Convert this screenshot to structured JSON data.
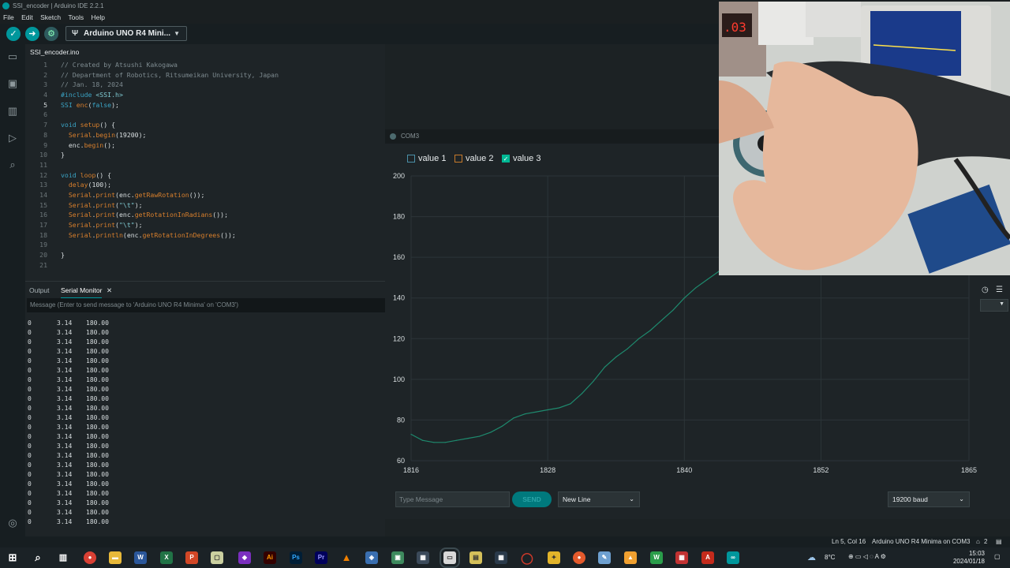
{
  "window": {
    "title": "SSI_encoder | Arduino IDE 2.2.1"
  },
  "menu": [
    "File",
    "Edit",
    "Sketch",
    "Tools",
    "Help"
  ],
  "toolbar": {
    "board": "Arduino UNO R4 Mini..."
  },
  "editor": {
    "file_tab": "SSI_encoder.ino",
    "current_line": 5,
    "lines": [
      "// Created by Atsushi Kakogawa",
      "// Department of Robotics, Ritsumeikan University, Japan",
      "// Jan. 18, 2024",
      "#include <SSI.h>",
      "SSI enc(false);",
      "",
      "void setup() {",
      "  Serial.begin(19200);",
      "  enc.begin();",
      "}",
      "",
      "void loop() {",
      "  delay(100);",
      "  Serial.print(enc.getRawRotation());",
      "  Serial.print(\"\\t\");",
      "  Serial.print(enc.getRotationInRadians());",
      "  Serial.print(\"\\t\");",
      "  Serial.println(enc.getRotationInDegrees());",
      "",
      "}",
      ""
    ]
  },
  "bottom_panel": {
    "tabs": [
      "Output",
      "Serial Monitor"
    ],
    "message_placeholder": "Message (Enter to send message to 'Arduino UNO R4 Minima' on 'COM3')",
    "serial_rows": [
      [
        "0",
        "3.14",
        "180.00"
      ],
      [
        "0",
        "3.14",
        "180.00"
      ],
      [
        "0",
        "3.14",
        "180.00"
      ],
      [
        "0",
        "3.14",
        "180.00"
      ],
      [
        "0",
        "3.14",
        "180.00"
      ],
      [
        "0",
        "3.14",
        "180.00"
      ],
      [
        "0",
        "3.14",
        "180.00"
      ],
      [
        "0",
        "3.14",
        "180.00"
      ],
      [
        "0",
        "3.14",
        "180.00"
      ],
      [
        "0",
        "3.14",
        "180.00"
      ],
      [
        "0",
        "3.14",
        "180.00"
      ],
      [
        "0",
        "3.14",
        "180.00"
      ],
      [
        "0",
        "3.14",
        "180.00"
      ],
      [
        "0",
        "3.14",
        "180.00"
      ],
      [
        "0",
        "3.14",
        "180.00"
      ],
      [
        "0",
        "3.14",
        "180.00"
      ],
      [
        "0",
        "3.14",
        "180.00"
      ],
      [
        "0",
        "3.14",
        "180.00"
      ],
      [
        "0",
        "3.14",
        "180.00"
      ],
      [
        "0",
        "3.14",
        "180.00"
      ],
      [
        "0",
        "3.14",
        "180.00"
      ],
      [
        "0",
        "3.14",
        "180.00"
      ]
    ]
  },
  "plotter": {
    "title": "COM3",
    "legend": [
      {
        "label": "value 1",
        "checked": false,
        "color": "#4a90a8"
      },
      {
        "label": "value 2",
        "checked": false,
        "color": "#c67a2b"
      },
      {
        "label": "value 3",
        "checked": true,
        "color": "#00b894"
      }
    ],
    "type_placeholder": "Type Message",
    "send_label": "SEND",
    "line_ending": "New Line",
    "baud": "19200 baud"
  },
  "chart_data": {
    "type": "line",
    "ylim": [
      60,
      200
    ],
    "yticks": [
      60,
      80,
      100,
      120,
      140,
      160,
      180,
      200
    ],
    "xlim": [
      1816,
      1865
    ],
    "xticks": [
      1816,
      1828,
      1840,
      1852,
      1865
    ],
    "series": [
      {
        "name": "value 3",
        "color": "#1e8a6e",
        "x": [
          1816,
          1817,
          1818,
          1819,
          1820,
          1821,
          1822,
          1823,
          1824,
          1825,
          1826,
          1827,
          1828,
          1829,
          1830,
          1831,
          1832,
          1833,
          1834,
          1835,
          1836,
          1837,
          1838,
          1839,
          1840,
          1841,
          1842,
          1843,
          1844,
          1845
        ],
        "y": [
          73,
          70,
          69,
          69,
          70,
          71,
          72,
          74,
          77,
          81,
          83,
          84,
          85,
          86,
          88,
          93,
          99,
          106,
          111,
          115,
          120,
          124,
          129,
          134,
          140,
          145,
          149,
          153,
          156,
          160
        ]
      }
    ]
  },
  "statusbar": {
    "position": "Ln 5, Col 16",
    "board": "Arduino UNO R4 Minima on COM3",
    "notifications": "2"
  },
  "taskbar": {
    "weather": "8°C",
    "time": "15:03",
    "date": "2024/01/18"
  }
}
